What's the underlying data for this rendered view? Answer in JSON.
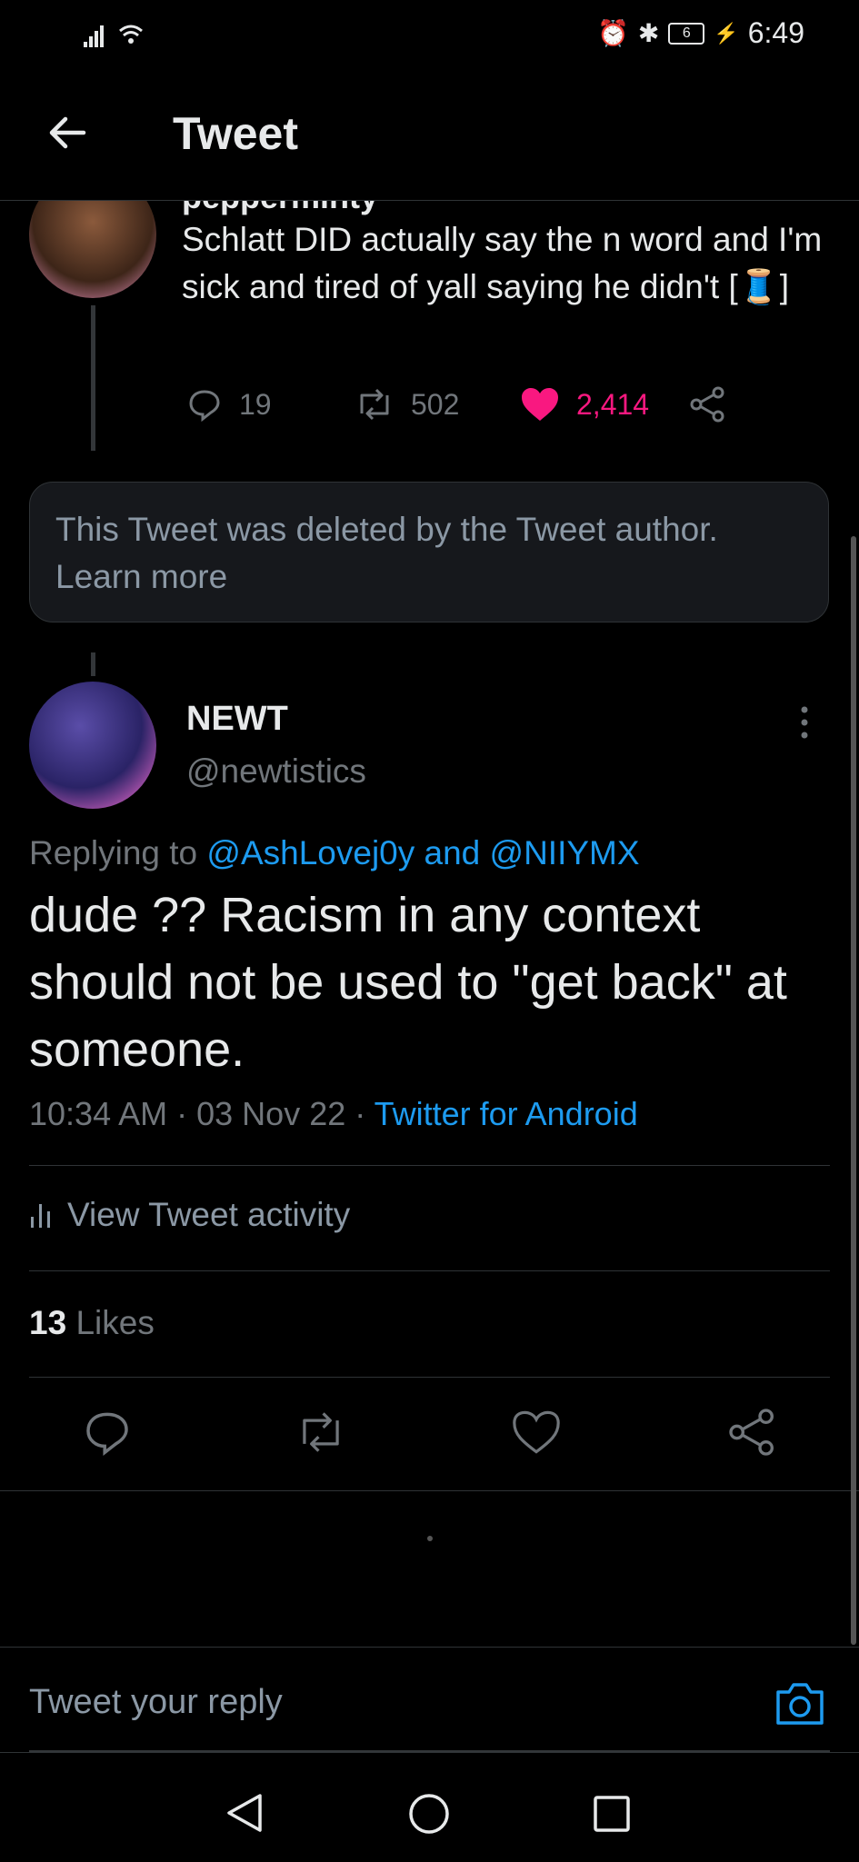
{
  "status_bar": {
    "time": "6:49",
    "battery": "6"
  },
  "header": {
    "title": "Tweet"
  },
  "parent_tweet": {
    "name_partial": "pepperminty",
    "text": "Schlatt DID actually say the n word and I'm sick and tired of yall saying he didn't [🧵]",
    "replies": "19",
    "retweets": "502",
    "likes": "2,414"
  },
  "deleted_notice": {
    "text": "This Tweet was deleted by the Tweet author.",
    "link": "Learn more"
  },
  "tweet": {
    "name": "NEWT",
    "handle": "@newtistics",
    "replying_label": "Replying to",
    "replying_to": "@AshLovej0y and @NIIYMX",
    "text": "dude ?? Racism in any context should not be used to \"get back\" at someone.",
    "time": "10:34 AM",
    "date": "03 Nov 22",
    "source": "Twitter for Android",
    "activity_label": "View Tweet activity",
    "likes_count": "13",
    "likes_label": "Likes"
  },
  "reply_bar": {
    "placeholder": "Tweet your reply"
  },
  "colors": {
    "accent": "#1d9bf0",
    "like": "#f91880",
    "background": "#000000"
  }
}
